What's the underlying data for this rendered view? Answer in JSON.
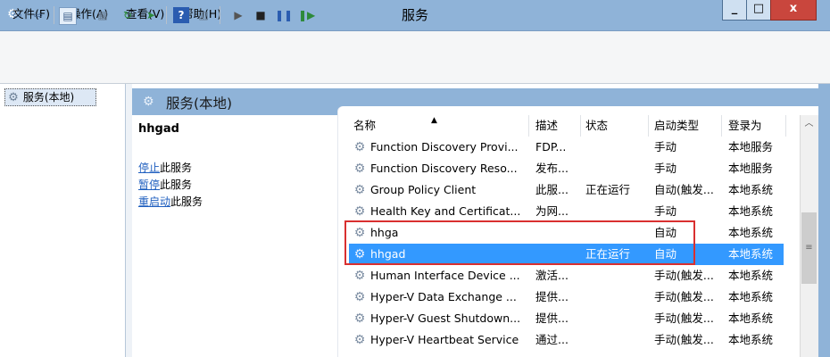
{
  "window": {
    "title": "服务",
    "minimize": "_",
    "maximize": "□",
    "close": "x"
  },
  "menu": [
    "文件(F)",
    "操作(A)",
    "查看(V)",
    "帮助(H)"
  ],
  "nav": {
    "item": "服务(本地)"
  },
  "panel": {
    "header": "服务(本地)",
    "selected_service": "hhgad",
    "actions": [
      {
        "link": "停止",
        "rest": "此服务"
      },
      {
        "link": "暂停",
        "rest": "此服务"
      },
      {
        "link": "重启动",
        "rest": "此服务"
      }
    ]
  },
  "columns": [
    "名称",
    "描述",
    "状态",
    "启动类型",
    "登录为"
  ],
  "rows": [
    {
      "name": "Function Discovery Provi...",
      "desc": "FDP...",
      "status": "",
      "start": "手动",
      "logon": "本地服务"
    },
    {
      "name": "Function Discovery Reso...",
      "desc": "发布...",
      "status": "",
      "start": "手动",
      "logon": "本地服务"
    },
    {
      "name": "Group Policy Client",
      "desc": "此服...",
      "status": "正在运行",
      "start": "自动(触发...",
      "logon": "本地系统"
    },
    {
      "name": "Health Key and Certificat...",
      "desc": "为网...",
      "status": "",
      "start": "手动",
      "logon": "本地系统"
    },
    {
      "name": "hhga",
      "desc": "",
      "status": "",
      "start": "自动",
      "logon": "本地系统"
    },
    {
      "name": "hhgad",
      "desc": "",
      "status": "正在运行",
      "start": "自动",
      "logon": "本地系统"
    },
    {
      "name": "Human Interface Device ...",
      "desc": "激活...",
      "status": "",
      "start": "手动(触发...",
      "logon": "本地系统"
    },
    {
      "name": "Hyper-V Data Exchange ...",
      "desc": "提供...",
      "status": "",
      "start": "手动(触发...",
      "logon": "本地系统"
    },
    {
      "name": "Hyper-V Guest Shutdown...",
      "desc": "提供...",
      "status": "",
      "start": "手动(触发...",
      "logon": "本地系统"
    },
    {
      "name": "Hyper-V Heartbeat Service",
      "desc": "通过...",
      "status": "",
      "start": "手动(触发...",
      "logon": "本地系统"
    }
  ],
  "selected_row_index": 5,
  "highlight_color": "#d93030",
  "accent_color": "#8fb3d8",
  "selection_color": "#3399ff"
}
